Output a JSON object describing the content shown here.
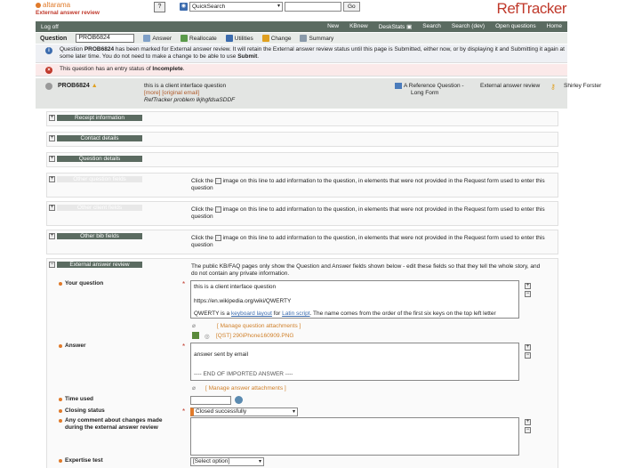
{
  "header": {
    "brand": "altarama",
    "brand_sub": "External answer review",
    "search_select": "QuickSearch",
    "search_button": "Go",
    "product": "RefTracker"
  },
  "nav": {
    "logoff": "Log off",
    "items": [
      "New",
      "KBnew",
      "DeskStats",
      "Search",
      "Search (dev)",
      "Open questions",
      "Home"
    ]
  },
  "toolbar": {
    "question_label": "Question",
    "question_value": "PROB6824",
    "actions": [
      "Answer",
      "Reallocate",
      "Utilities",
      "Change",
      "Summary"
    ]
  },
  "alerts": {
    "info": "Question PROB6824 has been marked for External answer review. It will retain the External answer review status until this page is Submitted, either now, or by displaying it and Submitting it again at some later time. You do not need to make a change to be able to use Submit.",
    "error": "This question has an entry status of Incomplete."
  },
  "summary": {
    "id": "PROB6824",
    "title": "this is a client interface question",
    "links": "[more] [original email]",
    "problem": "RefTracker problem lkjhgfdsaSDDF",
    "type_line1": "A Reference Question -",
    "type_line2": "Long Form",
    "review": "External answer review",
    "person": "Shirley Forster"
  },
  "sections": {
    "receipt": "Receipt information",
    "contact": "Contact details",
    "question": "Question details",
    "other_question": "Other question fields",
    "other_client": "Other client fields",
    "other_bib": "Other bib fields",
    "external_review": "External answer review",
    "hint": "Click the  image on this line to add information to the question, in elements that were not provided in the Request form used to enter this question",
    "review_hint": "The public KB/FAQ pages only show the Question and Answer fields shown below - edit these fields so that they tell the whole story, and do not contain any private information."
  },
  "form": {
    "your_question_label": "Your question",
    "your_question_line1": "this is a client interface question",
    "your_question_line2": "https://en.wikipedia.org/wiki/QWERTY",
    "your_question_line3_pre": "QWERTY is a ",
    "your_question_link1": "keyboard layout",
    "your_question_mid": " for ",
    "your_question_link2": "Latin script",
    "your_question_line3_post": ". The name comes from the order of the first six keys on the top left letter",
    "manage_question_attachments": "[ Manage question attachments ]",
    "attachment_file": "[QST]  290iPhone160909.PNG",
    "answer_label": "Answer",
    "answer_line1": "answer sent by email",
    "answer_line2": "---- END OF IMPORTED ANSWER ----",
    "manage_answer_attachments": "[ Manage answer attachments ]",
    "time_used_label": "Time used",
    "closing_status_label": "Closing status",
    "closing_status_value": "Closed successfully",
    "comment_label": "Any comment about changes made during the external answer review",
    "expertise_label": "Expertise test",
    "expertise_value": "[Select option]"
  }
}
